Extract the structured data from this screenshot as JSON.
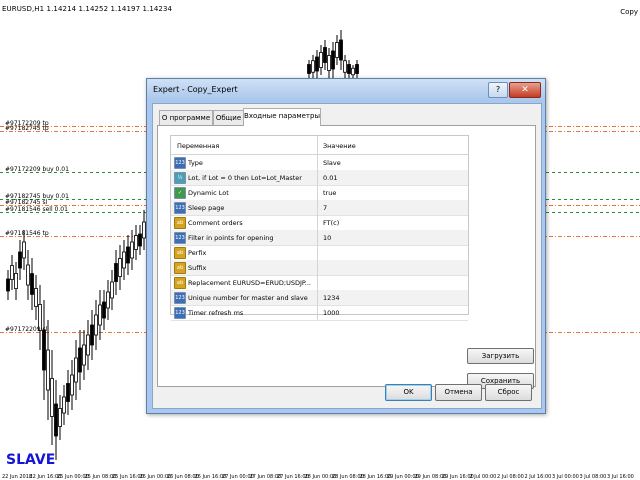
{
  "chart": {
    "title": "EURUSD,H1  1.14214 1.14252 1.14197 1.14234",
    "copy_label": "Copy",
    "slave_label": "SLAVE",
    "level_labels": [
      {
        "text": "#97172209 tp"
      },
      {
        "text": "#97182745 tp"
      },
      {
        "text": "#97172209 buy 0.01"
      },
      {
        "text": "#97182745 buy 0.01"
      },
      {
        "text": "#97182745 sl"
      },
      {
        "text": "#97181546 sell 0.01"
      },
      {
        "text": "#97181546 tp"
      },
      {
        "text": "#97172209 sl"
      }
    ],
    "date_labels": [
      "22 Jun 2018",
      "22 Jun 16:00",
      "25 Jun 00:00",
      "25 Jun 08:00",
      "25 Jun 16:00",
      "26 Jun 00:00",
      "26 Jun 08:00",
      "26 Jun 16:00",
      "27 Jun 00:00",
      "27 Jun 08:00",
      "27 Jun 16:00",
      "28 Jun 00:00",
      "28 Jun 08:00",
      "28 Jun 16:00",
      "29 Jun 00:00",
      "29 Jun 08:00",
      "29 Jun 16:00",
      "2 Jul 00:00",
      "2 Jul 08:00",
      "2 Jul 16:00",
      "3 Jul 00:00",
      "3 Jul 08:00",
      "3 Jul 16:00"
    ],
    "colors": {
      "orange_line": "#e8743a",
      "green_line": "#2e8b3a",
      "candle": "#000000",
      "slave": "#1515d8"
    }
  },
  "dialog": {
    "title": "Expert - Copy_Expert",
    "help_label": "?",
    "close_label": "✕",
    "tabs": [
      {
        "label": "О программе"
      },
      {
        "label": "Общие"
      },
      {
        "label": "Входные параметры"
      }
    ],
    "active_tab": "Входные параметры",
    "table": {
      "header_variable": "Переменная",
      "header_value": "Значение",
      "rows": [
        {
          "type": "int",
          "icon": "123",
          "variable": "Type",
          "value": "Slave"
        },
        {
          "type": "double",
          "icon": "½",
          "variable": "Lot, if Lot = 0 then Lot=Lot_Master",
          "value": "0.01"
        },
        {
          "type": "bool",
          "icon": "✓",
          "variable": "Dynamic Lot",
          "value": "true"
        },
        {
          "type": "int",
          "icon": "123",
          "variable": "Sleep page",
          "value": "7"
        },
        {
          "type": "string",
          "icon": "ab",
          "variable": "Comment orders",
          "value": "FT(c)"
        },
        {
          "type": "int",
          "icon": "123",
          "variable": "Filter in points for opening",
          "value": "10"
        },
        {
          "type": "string",
          "icon": "ab",
          "variable": "Perfix",
          "value": ""
        },
        {
          "type": "string",
          "icon": "ab",
          "variable": "Suffix",
          "value": ""
        },
        {
          "type": "string",
          "icon": "ab",
          "variable": "Replacement EURUSD=ERUD;USDJP...",
          "value": ""
        },
        {
          "type": "int",
          "icon": "123",
          "variable": "Unique number for master and slave",
          "value": "1234"
        },
        {
          "type": "int",
          "icon": "123",
          "variable": "Timer refresh ms",
          "value": "1000"
        }
      ]
    },
    "buttons": {
      "load": "Загрузить",
      "save": "Сохранить",
      "ok": "OK",
      "cancel": "Отмена",
      "reset": "Сброс"
    }
  }
}
